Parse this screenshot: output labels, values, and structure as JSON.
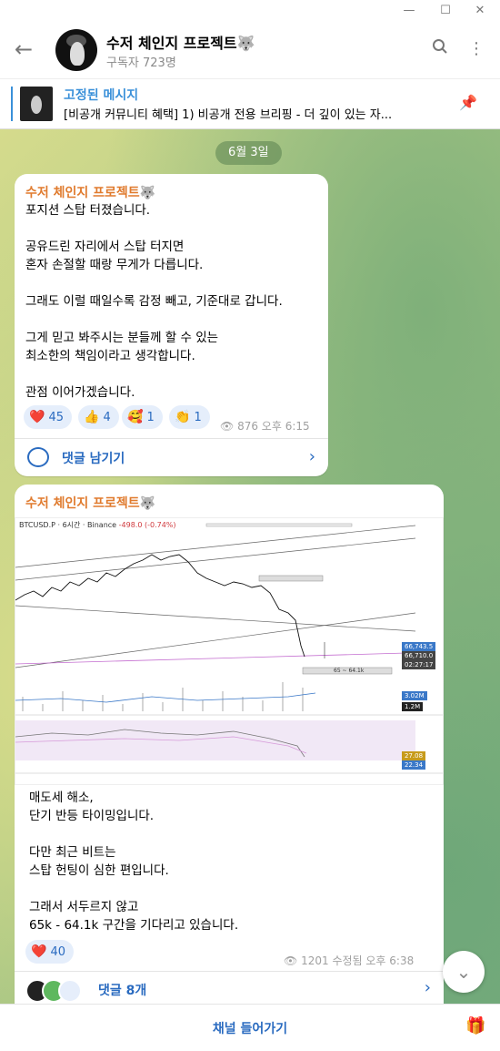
{
  "window": {
    "minimize": "—",
    "maximize": "☐",
    "close": "✕"
  },
  "header": {
    "title": "수저 체인지 프로젝트🐺",
    "subtitle": "구독자 723명"
  },
  "pinned": {
    "title": "고정된 메시지",
    "text": "[비공개 커뮤니티 혜택] 1) 비공개 전용 브리핑 - 더 깊이 있는 자..."
  },
  "date_pill": "6월 3일",
  "message1": {
    "sender": "수저 체인지 프로젝트🐺",
    "text": "포지션 스탑 터졌습니다.\n\n공유드린 자리에서 스탑 터지면\n혼자 손절할 때랑 무게가 다릅니다.\n\n그래도 이럴 때일수록 감정 빼고, 기준대로 갑니다.\n\n그게 믿고 봐주시는 분들께 할 수 있는\n최소한의 책임이라고 생각합니다.\n\n관점 이어가겠습니다.",
    "reactions": [
      {
        "emoji": "❤️",
        "count": "45"
      },
      {
        "emoji": "👍",
        "count": "4"
      },
      {
        "emoji": "🥰",
        "count": "1"
      },
      {
        "emoji": "👏",
        "count": "1"
      }
    ],
    "views": "876",
    "time": "오후 6:15",
    "comment_label": "댓글 남기기"
  },
  "message2": {
    "sender": "수저 체인지 프로젝트🐺",
    "chart_header": "BTCUSD.P · 6시간 · Binance",
    "chart_change": "-498.0 (-0.74%)",
    "chart_prices": {
      "p1": "66,743.5",
      "p2": "66,710.0",
      "p3": "02:27:17",
      "vol": "3.02M",
      "vol2": "1.2M",
      "ind1": "27.08",
      "ind2": "22.34"
    },
    "zone_label": "65 ~ 64.1k",
    "text": "매도세 해소,\n단기 반등 타이밍입니다.\n\n다만 최근 비트는\n스탑 헌팅이 심한 편입니다.\n\n그래서 서두르지 않고\n65k - 64.1k 구간을 기다리고 있습니다.",
    "reactions": [
      {
        "emoji": "❤️",
        "count": "40"
      }
    ],
    "views": "1201",
    "time": "수정됨 오후 6:38",
    "comment_label": "댓글 8개"
  },
  "bottom": {
    "join": "채널 들어가기"
  },
  "colors": {
    "accent": "#2a6bc0",
    "sender": "#e07b2e"
  }
}
